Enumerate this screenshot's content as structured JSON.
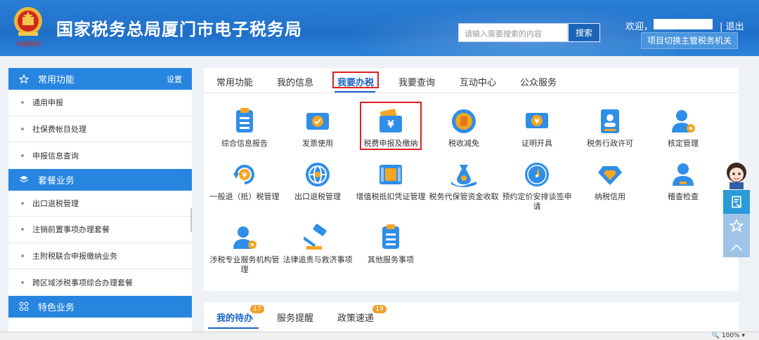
{
  "header": {
    "title": "国家税务总局厦门市电子税务局",
    "emblem_text": "中国税务",
    "search_placeholder": "请输入需要搜索的内容",
    "search_button": "搜索",
    "welcome": "欢迎，",
    "logout": "| 退出",
    "switch_button": "项目切换主管税务机关"
  },
  "sidebar": {
    "sections": [
      {
        "title": "常用功能",
        "icon": "star-icon",
        "setting": "设置",
        "items": [
          "通用申报",
          "社保费帐目处理",
          "申报信息查询"
        ]
      },
      {
        "title": "套餐业务",
        "icon": "layers-icon",
        "items": [
          "出口退税管理",
          "注销前置事项办理套餐",
          "主附税联合申报缴纳业务",
          "跨区域涉税事项综合办理套餐"
        ]
      },
      {
        "title": "特色业务",
        "icon": "grid-icon",
        "items": []
      }
    ]
  },
  "main": {
    "tabs": [
      "常用功能",
      "我的信息",
      "我要办税",
      "我要查询",
      "互动中心",
      "公众服务"
    ],
    "active_tab": "我要办税",
    "services": [
      "综合信息报告",
      "发票使用",
      "税费申报及缴纳",
      "税收减免",
      "证明开具",
      "税务行政许可",
      "核定管理",
      "一般退（抵）税管理",
      "出口退税管理",
      "增值税抵扣凭证管理",
      "税务代保管资金收取",
      "预约定价安排谈签申请",
      "纳税信用",
      "稽查检查",
      "涉税专业服务机构管理",
      "法律追责与救济事项",
      "其他服务事项"
    ],
    "highlighted_service": "税费申报及缴纳"
  },
  "bottom": {
    "tabs": [
      {
        "label": "我的待办",
        "badge": "17"
      },
      {
        "label": "服务提醒",
        "badge": ""
      },
      {
        "label": "政策速递",
        "badge": "19"
      }
    ]
  },
  "status": {
    "zoom": "100%"
  },
  "colors": {
    "primary": "#2785e0",
    "accent": "#1a63c8",
    "highlight": "#e02020",
    "badge": "#f0a12a"
  }
}
